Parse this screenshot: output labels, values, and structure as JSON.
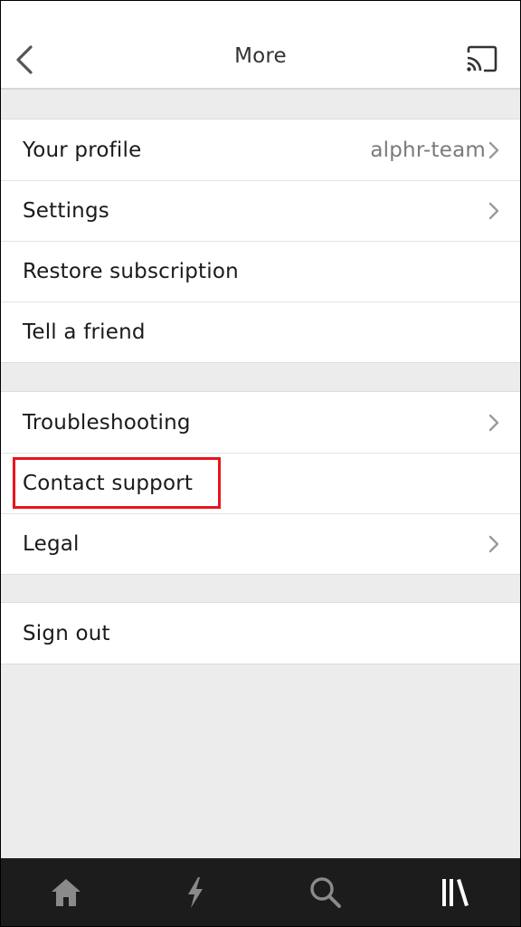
{
  "header": {
    "title": "More",
    "back_icon": "chevron-left-icon",
    "cast_icon": "cast-icon"
  },
  "groups": [
    {
      "items": [
        {
          "label": "Your profile",
          "value": "alphr-team",
          "chevron": true
        },
        {
          "label": "Settings",
          "value": "",
          "chevron": true
        },
        {
          "label": "Restore subscription",
          "value": "",
          "chevron": false
        },
        {
          "label": "Tell a friend",
          "value": "",
          "chevron": false
        }
      ]
    },
    {
      "items": [
        {
          "label": "Troubleshooting",
          "value": "",
          "chevron": true
        },
        {
          "label": "Contact support",
          "value": "",
          "chevron": false,
          "highlighted": true
        },
        {
          "label": "Legal",
          "value": "",
          "chevron": true
        }
      ]
    },
    {
      "items": [
        {
          "label": "Sign out",
          "value": "",
          "chevron": false
        }
      ]
    }
  ],
  "tabbar": {
    "tabs": [
      {
        "icon": "home-icon"
      },
      {
        "icon": "lightning-icon"
      },
      {
        "icon": "search-icon"
      },
      {
        "icon": "library-icon",
        "active": true
      }
    ]
  },
  "colors": {
    "highlight": "#e8141e",
    "tabbar_bg": "#1c1c1c",
    "tab_icon": "#8a8a8a",
    "tab_icon_active": "#ffffff"
  }
}
